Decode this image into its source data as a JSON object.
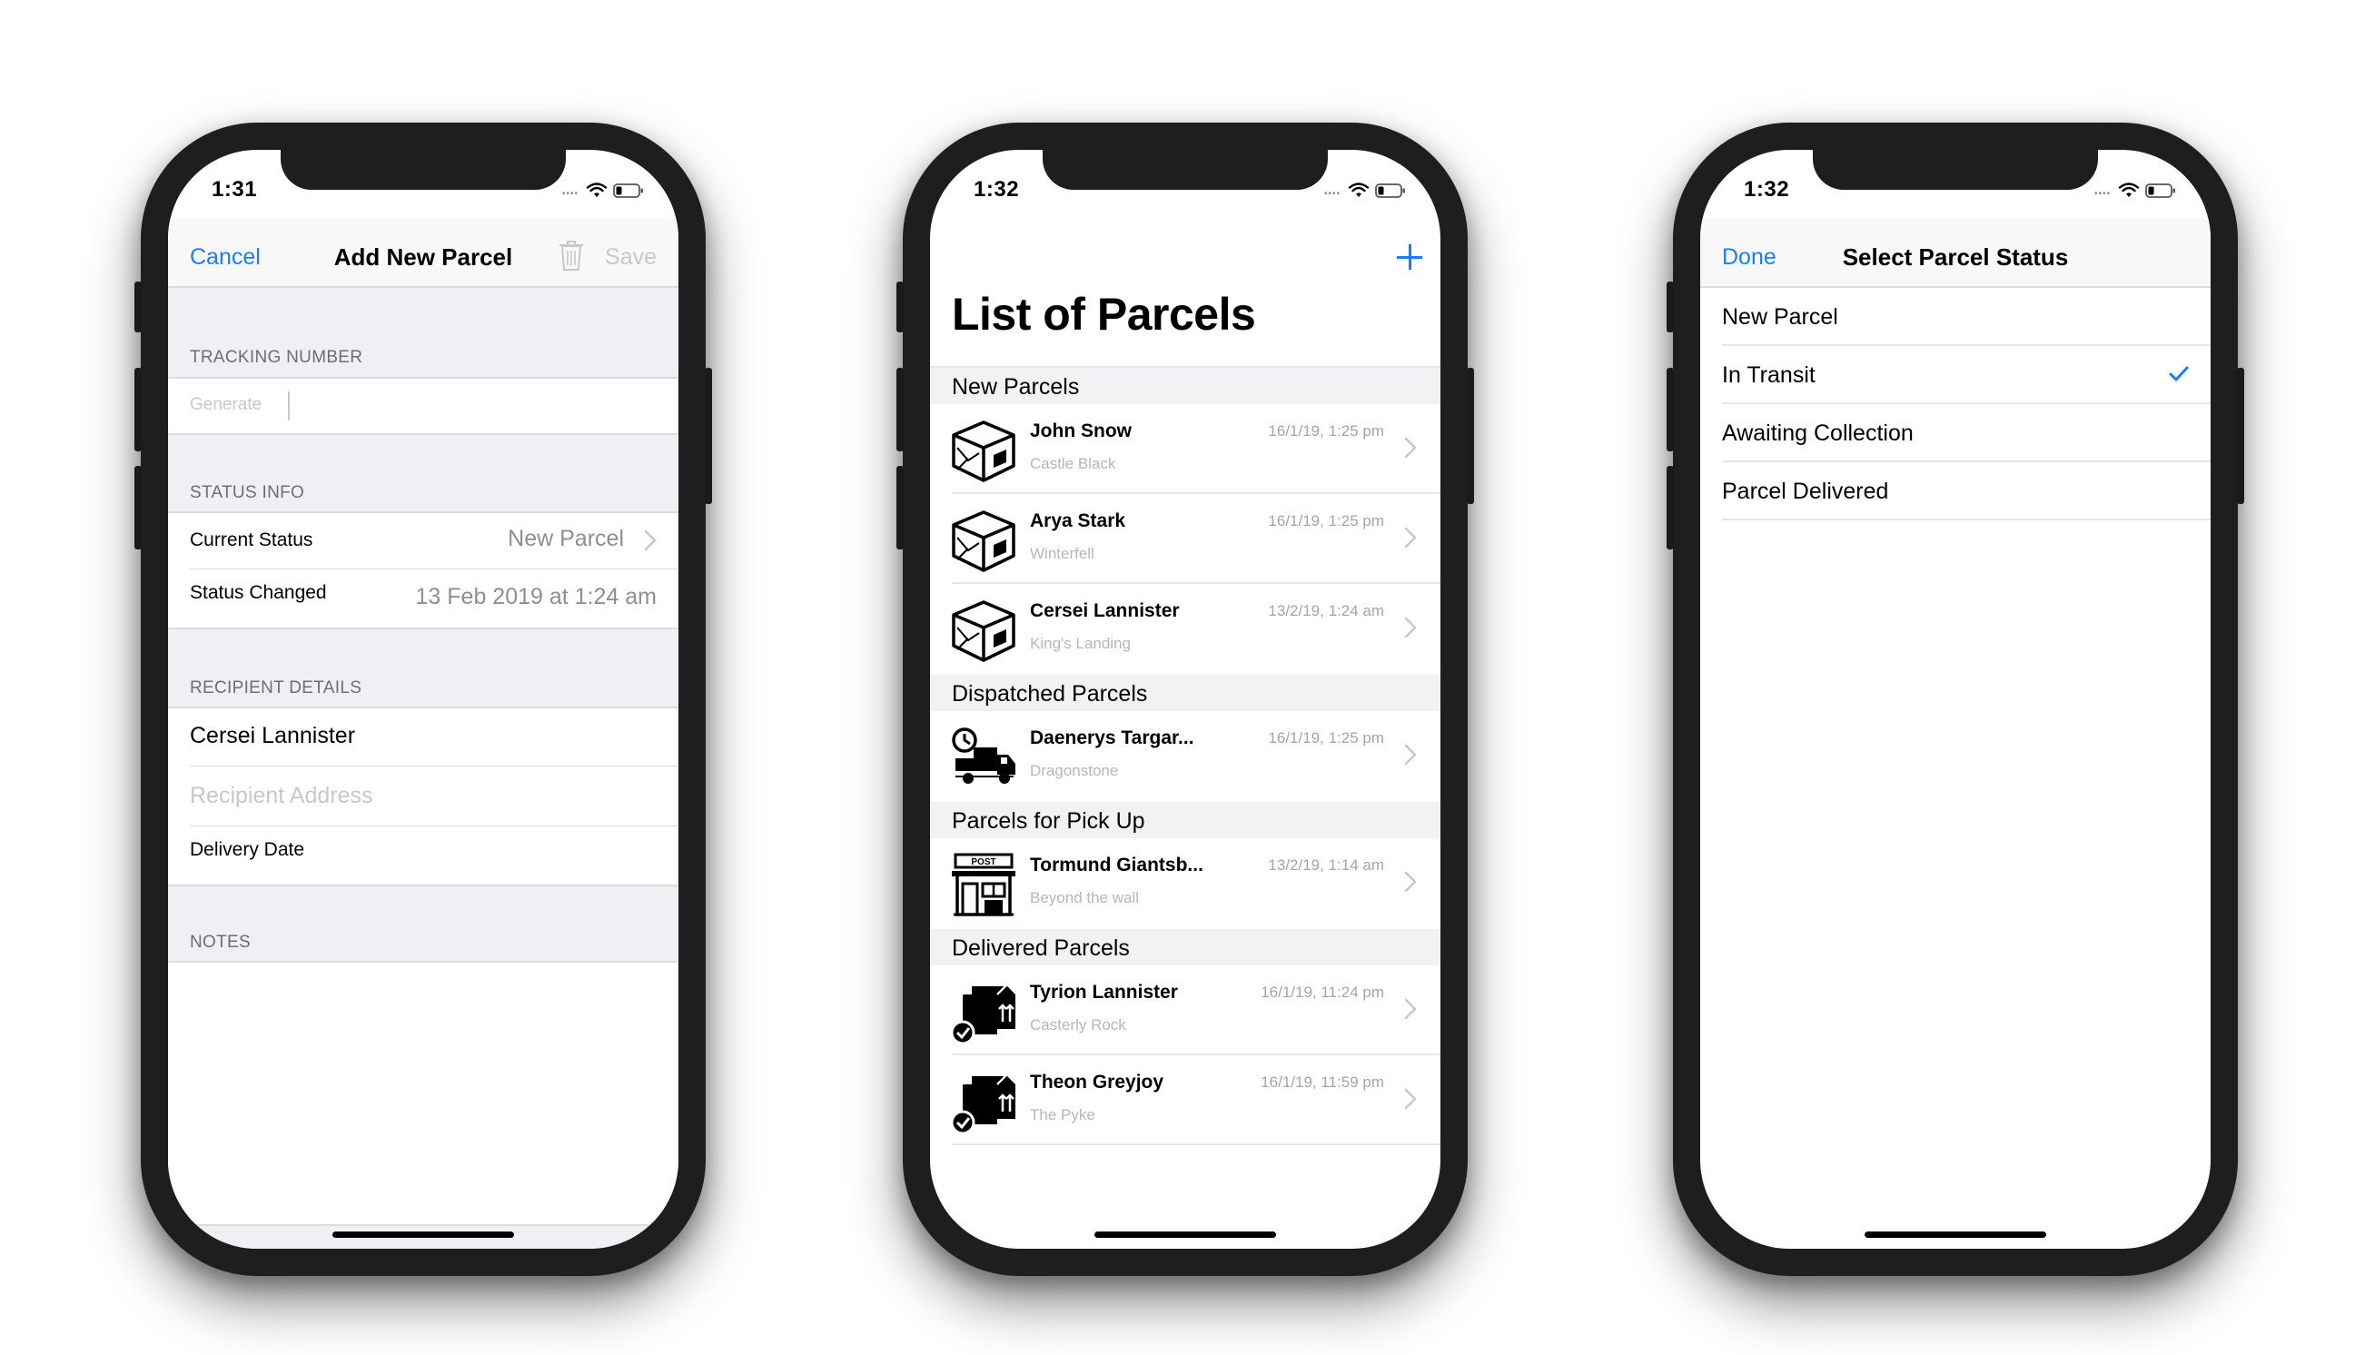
{
  "theme": {
    "accent": "#1c7ef6",
    "secondary_text": "#8e8e93",
    "placeholder": "#c7c7cc",
    "group_bg": "#efeff4"
  },
  "screen1": {
    "status_time": "1:31",
    "nav": {
      "cancel": "Cancel",
      "title": "Add New Parcel",
      "save": "Save"
    },
    "sections": {
      "tracking": "TRACKING NUMBER",
      "status": "STATUS INFO",
      "recipient": "RECIPIENT DETAILS",
      "notes": "NOTES"
    },
    "tracking": {
      "generate": "Generate"
    },
    "status": {
      "current_label": "Current Status",
      "current_value": "New Parcel",
      "changed_label": "Status Changed",
      "changed_value": "13 Feb 2019 at 1:24 am"
    },
    "recipient": {
      "name": "Cersei Lannister",
      "address_placeholder": "Recipient Address",
      "delivery_label": "Delivery Date"
    }
  },
  "screen2": {
    "status_time": "1:32",
    "title": "List of Parcels",
    "sections": [
      {
        "title": "New Parcels",
        "items": [
          {
            "name": "John Snow",
            "place": "Castle Black",
            "date": "16/1/19, 1:25 pm",
            "icon": "box-icon"
          },
          {
            "name": "Arya Stark",
            "place": "Winterfell",
            "date": "16/1/19, 1:25 pm",
            "icon": "box-icon"
          },
          {
            "name": "Cersei Lannister",
            "place": "King's Landing",
            "date": "13/2/19, 1:24 am",
            "icon": "box-icon"
          }
        ]
      },
      {
        "title": "Dispatched Parcels",
        "items": [
          {
            "name": "Daenerys Targar...",
            "place": "Dragonstone",
            "date": "16/1/19, 1:25 pm",
            "icon": "truck-icon"
          }
        ]
      },
      {
        "title": "Parcels for Pick Up",
        "items": [
          {
            "name": "Tormund Giantsb...",
            "place": "Beyond the wall",
            "date": "13/2/19, 1:14 am",
            "icon": "post-office-icon"
          }
        ]
      },
      {
        "title": "Delivered Parcels",
        "items": [
          {
            "name": "Tyrion Lannister",
            "place": "Casterly Rock",
            "date": "16/1/19, 11:24 pm",
            "icon": "delivered-box-icon"
          },
          {
            "name": "Theon Greyjoy",
            "place": "The Pyke",
            "date": "16/1/19, 11:59 pm",
            "icon": "delivered-box-icon"
          }
        ]
      }
    ]
  },
  "screen3": {
    "status_time": "1:32",
    "nav": {
      "done": "Done",
      "title": "Select Parcel Status"
    },
    "options": [
      "New Parcel",
      "In Transit",
      "Awaiting Collection",
      "Parcel Delivered"
    ],
    "selected": "In Transit"
  }
}
